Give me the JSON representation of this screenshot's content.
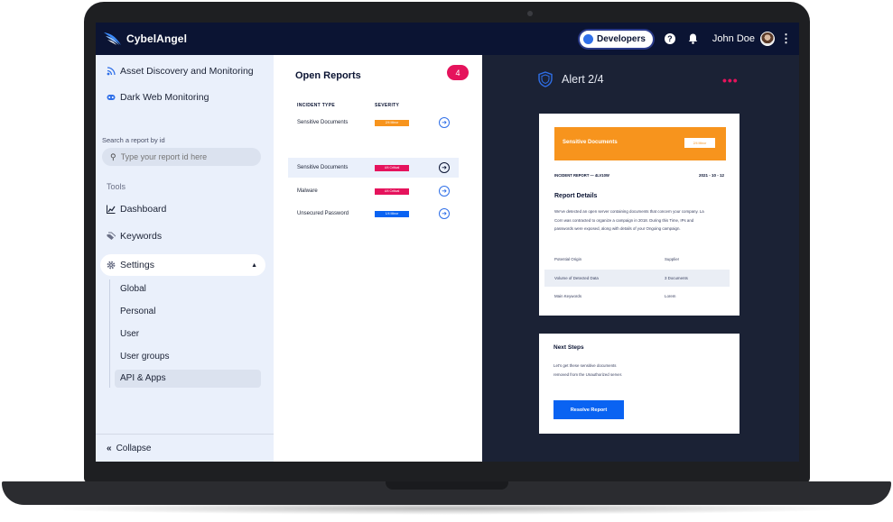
{
  "app": {
    "brand": "CybelAngel",
    "developers_label": "Developers",
    "help_icon": "?",
    "user_name": "John Doe"
  },
  "sidebar": {
    "top_items": [
      {
        "label": "Asset Discovery and Monitoring",
        "icon": "rss-icon"
      },
      {
        "label": "Dark Web Monitoring",
        "icon": "mask-icon"
      }
    ],
    "search": {
      "label": "Search a report by id",
      "placeholder": "Type your report id here"
    },
    "tools_label": "Tools",
    "tools": [
      {
        "label": "Dashboard",
        "icon": "chart-icon"
      },
      {
        "label": "Keywords",
        "icon": "tags-icon"
      }
    ],
    "settings": {
      "label": "Settings",
      "expanded": true,
      "sub_items": [
        "Global",
        "Personal",
        "User",
        "User groups",
        "API & Apps"
      ],
      "active_sub_item": "API & Apps"
    },
    "collapse_label": "Collapse"
  },
  "reports": {
    "title": "Open Reports",
    "count": "4",
    "col_type": "INCIDENT TYPE",
    "col_severity": "SEVERITY",
    "rows": [
      {
        "type": "Sensitive Documents",
        "severity": "2/4 Minor",
        "color": "#f7941d"
      },
      {
        "type": "Sensitive Documents",
        "severity": "4/4 Critical",
        "color": "#e5135c"
      },
      {
        "type": "Malware",
        "severity": "4/4 Critical",
        "color": "#e5135c"
      },
      {
        "type": "Unsecured Password",
        "severity": "1/4 Minor",
        "color": "#0a63f2"
      }
    ],
    "active_row": 1
  },
  "alert": {
    "title": "Alert 2/4",
    "more": "•••",
    "card": {
      "banner_title": "Sensitive Documents",
      "banner_badge": "2/4 Minor",
      "report_id": "INCIDENT REPORT — 4LV10W",
      "date": "2021 - 10 - 12",
      "details_heading": "Report Details",
      "details_text": "We've detected an open server containing documents that concern your company. La Corn was contracted to organize a campaign in 2018. During this Time, IPs and passwords were exposed, along with details of your Ongoing campaign.",
      "fields": [
        {
          "key": "Potential Origin",
          "value": "Supplier"
        },
        {
          "key": "Volume of Detected Data",
          "value": "3 Documents"
        },
        {
          "key": "Main Keywords",
          "value": "Lorem"
        }
      ]
    },
    "next": {
      "heading": "Next Steps",
      "text": "Let's get these sensitive documents removed from the Unauthorized server.",
      "button": "Resolve Report"
    }
  },
  "colors": {
    "navy": "#0b1433",
    "accent_pink": "#e5135c",
    "accent_orange": "#f7941d",
    "accent_blue": "#0a63f2",
    "sidebar_bg": "#eaf0fb"
  }
}
